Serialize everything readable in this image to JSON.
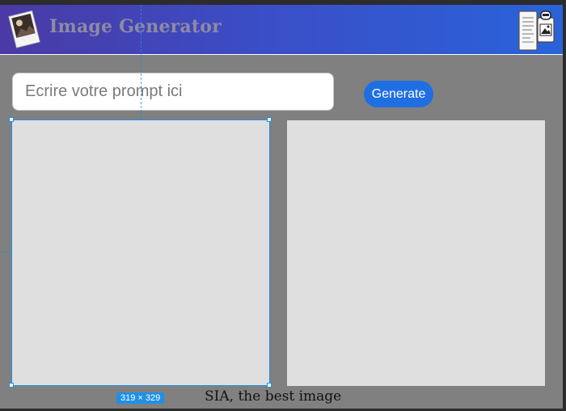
{
  "header": {
    "title": "Image Generator",
    "logo_icon": "polaroid-photo-icon",
    "action_icon": "documents-clipboard-icon",
    "gradient_start": "#4a3aa5",
    "gradient_end": "#2a63d9"
  },
  "prompt": {
    "placeholder": "Ecrire votre prompt ici",
    "value": ""
  },
  "generate_button": {
    "label": "Generate",
    "color": "#1f6fe3"
  },
  "panels": {
    "left_color": "#dfdfdf",
    "right_color": "#dfdfdf"
  },
  "editor_overlay": {
    "selection_size_label": "319 × 329",
    "selection_color": "#1e90e6"
  },
  "footer": {
    "text": "SIA, the best image"
  }
}
